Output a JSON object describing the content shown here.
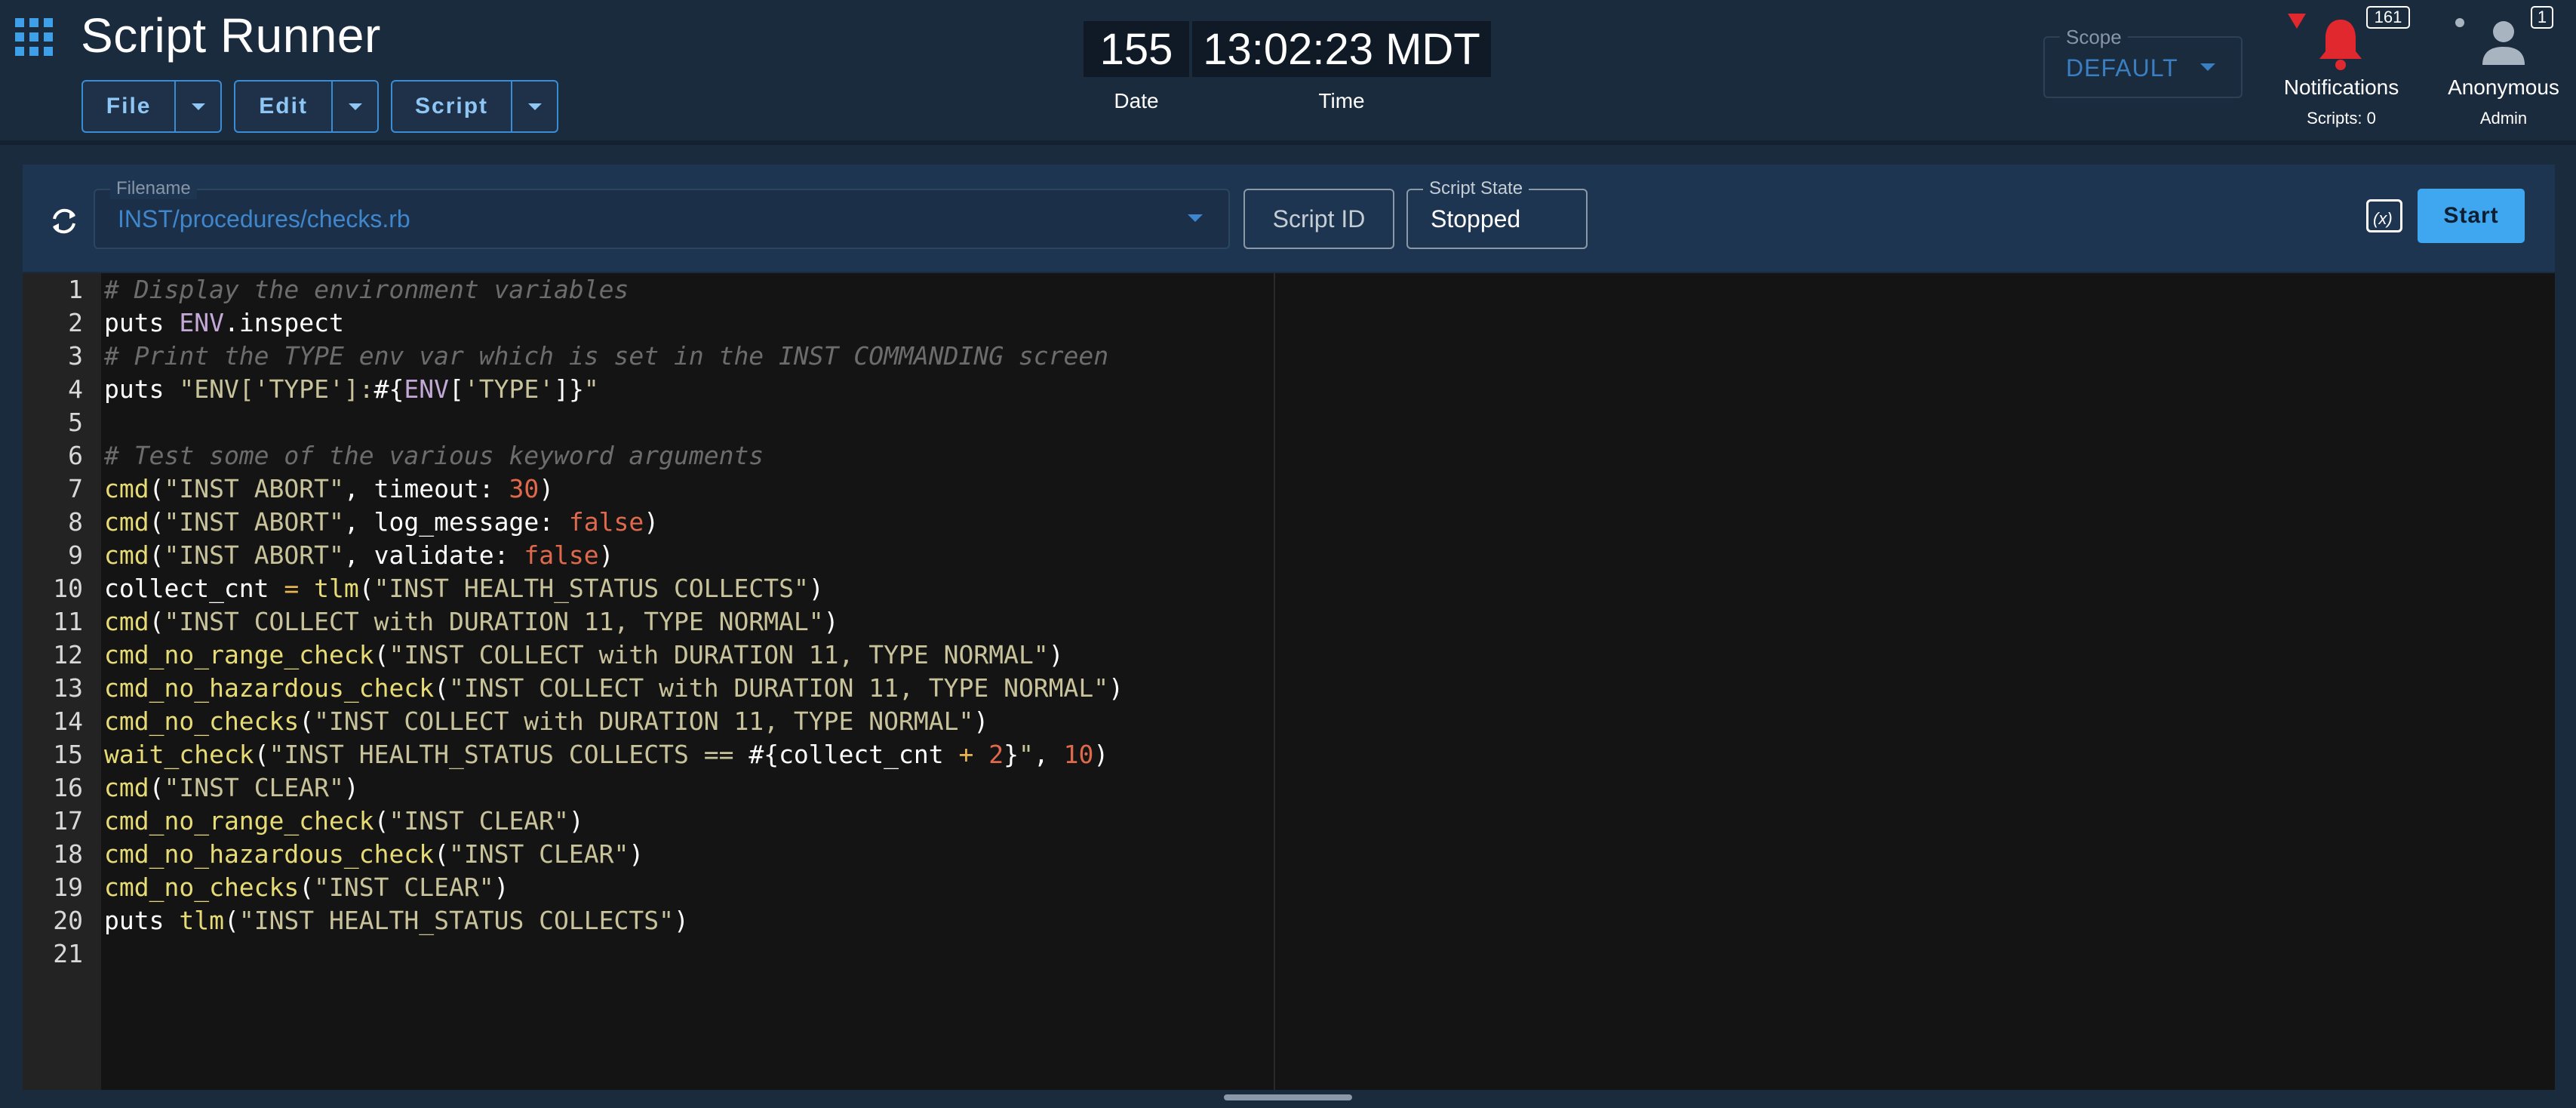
{
  "app": {
    "title": "Script Runner"
  },
  "menus": [
    {
      "label": "File"
    },
    {
      "label": "Edit"
    },
    {
      "label": "Script"
    }
  ],
  "clock": {
    "date_value": "155",
    "time_value": "13:02:23 MDT",
    "date_caption": "Date",
    "time_caption": "Time"
  },
  "scope": {
    "legend": "Scope",
    "value": "DEFAULT"
  },
  "notifications": {
    "label": "Notifications",
    "sub": "Scripts: 0",
    "count": "161",
    "color": "#e0282e"
  },
  "user": {
    "name": "Anonymous",
    "role": "Admin",
    "count": "1"
  },
  "toolbar": {
    "filename_legend": "Filename",
    "filename": "INST/procedures/checks.rb",
    "script_id_placeholder": "Script ID",
    "state_legend": "Script State",
    "state": "Stopped",
    "start_label": "Start",
    "var_icon_text": "(x)"
  },
  "colors": {
    "accent": "#3ea7f0",
    "header_bg": "#1b2b3e",
    "toolbar_bg": "#1e3551"
  },
  "code": {
    "lines": [
      [
        [
          "com",
          "# Display the environment variables"
        ]
      ],
      [
        [
          "id",
          "puts "
        ],
        [
          "const",
          "ENV"
        ],
        [
          "id",
          ".inspect"
        ]
      ],
      [
        [
          "com",
          "# Print the TYPE env var which is set in the INST COMMANDING screen"
        ]
      ],
      [
        [
          "id",
          "puts "
        ],
        [
          "str",
          "\"ENV['TYPE']:"
        ],
        [
          "id",
          "#{"
        ],
        [
          "const",
          "ENV"
        ],
        [
          "id",
          "["
        ],
        [
          "str",
          "'TYPE'"
        ],
        [
          "id",
          "]}"
        ],
        [
          "str",
          "\""
        ]
      ],
      [],
      [
        [
          "com",
          "# Test some of the various keyword arguments"
        ]
      ],
      [
        [
          "fn",
          "cmd"
        ],
        [
          "id",
          "("
        ],
        [
          "str",
          "\"INST ABORT\""
        ],
        [
          "id",
          ", timeout: "
        ],
        [
          "num",
          "30"
        ],
        [
          "id",
          ")"
        ]
      ],
      [
        [
          "fn",
          "cmd"
        ],
        [
          "id",
          "("
        ],
        [
          "str",
          "\"INST ABORT\""
        ],
        [
          "id",
          ", log_message: "
        ],
        [
          "num",
          "false"
        ],
        [
          "id",
          ")"
        ]
      ],
      [
        [
          "fn",
          "cmd"
        ],
        [
          "id",
          "("
        ],
        [
          "str",
          "\"INST ABORT\""
        ],
        [
          "id",
          ", validate: "
        ],
        [
          "num",
          "false"
        ],
        [
          "id",
          ")"
        ]
      ],
      [
        [
          "id",
          "collect_cnt "
        ],
        [
          "op",
          "="
        ],
        [
          "id",
          " "
        ],
        [
          "fn",
          "tlm"
        ],
        [
          "id",
          "("
        ],
        [
          "str",
          "\"INST HEALTH_STATUS COLLECTS\""
        ],
        [
          "id",
          ")"
        ]
      ],
      [
        [
          "fn",
          "cmd"
        ],
        [
          "id",
          "("
        ],
        [
          "str",
          "\"INST COLLECT with DURATION 11, TYPE NORMAL\""
        ],
        [
          "id",
          ")"
        ]
      ],
      [
        [
          "fn",
          "cmd_no_range_check"
        ],
        [
          "id",
          "("
        ],
        [
          "str",
          "\"INST COLLECT with DURATION 11, TYPE NORMAL\""
        ],
        [
          "id",
          ")"
        ]
      ],
      [
        [
          "fn",
          "cmd_no_hazardous_check"
        ],
        [
          "id",
          "("
        ],
        [
          "str",
          "\"INST COLLECT with DURATION 11, TYPE NORMAL\""
        ],
        [
          "id",
          ")"
        ]
      ],
      [
        [
          "fn",
          "cmd_no_checks"
        ],
        [
          "id",
          "("
        ],
        [
          "str",
          "\"INST COLLECT with DURATION 11, TYPE NORMAL\""
        ],
        [
          "id",
          ")"
        ]
      ],
      [
        [
          "fn",
          "wait_check"
        ],
        [
          "id",
          "("
        ],
        [
          "str",
          "\"INST HEALTH_STATUS COLLECTS == "
        ],
        [
          "id",
          "#{collect_cnt "
        ],
        [
          "op",
          "+"
        ],
        [
          "id",
          " "
        ],
        [
          "num",
          "2"
        ],
        [
          "id",
          "}"
        ],
        [
          "str",
          "\""
        ],
        [
          "id",
          ", "
        ],
        [
          "num",
          "10"
        ],
        [
          "id",
          ")"
        ]
      ],
      [
        [
          "fn",
          "cmd"
        ],
        [
          "id",
          "("
        ],
        [
          "str",
          "\"INST CLEAR\""
        ],
        [
          "id",
          ")"
        ]
      ],
      [
        [
          "fn",
          "cmd_no_range_check"
        ],
        [
          "id",
          "("
        ],
        [
          "str",
          "\"INST CLEAR\""
        ],
        [
          "id",
          ")"
        ]
      ],
      [
        [
          "fn",
          "cmd_no_hazardous_check"
        ],
        [
          "id",
          "("
        ],
        [
          "str",
          "\"INST CLEAR\""
        ],
        [
          "id",
          ")"
        ]
      ],
      [
        [
          "fn",
          "cmd_no_checks"
        ],
        [
          "id",
          "("
        ],
        [
          "str",
          "\"INST CLEAR\""
        ],
        [
          "id",
          ")"
        ]
      ],
      [
        [
          "id",
          "puts "
        ],
        [
          "fn",
          "tlm"
        ],
        [
          "id",
          "("
        ],
        [
          "str",
          "\"INST HEALTH_STATUS COLLECTS\""
        ],
        [
          "id",
          ")"
        ]
      ],
      []
    ]
  }
}
